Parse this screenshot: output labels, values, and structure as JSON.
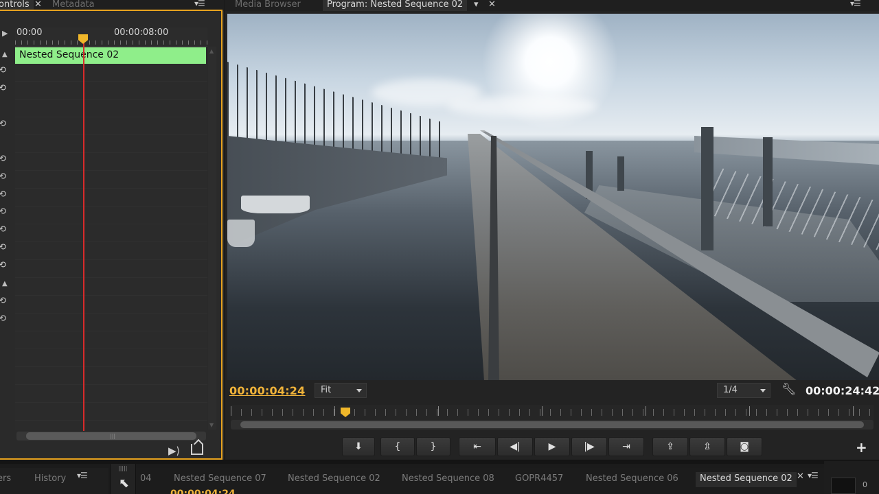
{
  "left_panel": {
    "tabs": [
      {
        "label": "ontrols",
        "active": true
      },
      {
        "label": "Metadata",
        "active": false
      }
    ],
    "ruler": {
      "start": "00:00",
      "mark": "00:00:08:00"
    },
    "clip_name": "Nested Sequence 02",
    "colors": {
      "clip": "#8fee8a",
      "playhead": "#d92a2a",
      "focus": "#e8a31f"
    }
  },
  "program": {
    "tabs": [
      {
        "label": "Media Browser",
        "active": false
      },
      {
        "label": "Program: Nested Sequence 02",
        "active": true
      }
    ],
    "playhead_timecode": "00:00:04:24",
    "zoom": "Fit",
    "resolution": "1/4",
    "duration_timecode": "00:00:24:42",
    "colors": {
      "timecode": "#f0b33a"
    },
    "transport": [
      {
        "name": "add-marker",
        "glyph": "⬇"
      },
      {
        "name": "mark-in",
        "glyph": "{"
      },
      {
        "name": "mark-out",
        "glyph": "}"
      },
      {
        "name": "go-to-in",
        "glyph": "⇤"
      },
      {
        "name": "step-back",
        "glyph": "◀|"
      },
      {
        "name": "play",
        "glyph": "▶"
      },
      {
        "name": "step-forward",
        "glyph": "|▶"
      },
      {
        "name": "go-to-out",
        "glyph": "⇥"
      },
      {
        "name": "lift",
        "glyph": "⇪"
      },
      {
        "name": "extract",
        "glyph": "⇫"
      },
      {
        "name": "export-frame",
        "glyph": "◙"
      }
    ],
    "add_button": "+"
  },
  "bottom": {
    "left_tabs": [
      {
        "label": "ers",
        "active": false
      },
      {
        "label": "History",
        "active": false
      }
    ],
    "sequence_tabs": [
      {
        "label": "04",
        "active": false
      },
      {
        "label": "Nested Sequence 07",
        "active": false
      },
      {
        "label": "Nested Sequence 02",
        "active": false
      },
      {
        "label": "Nested Sequence 08",
        "active": false
      },
      {
        "label": "GOPR4457",
        "active": false
      },
      {
        "label": "Nested Sequence 06",
        "active": false
      },
      {
        "label": "Nested Sequence 02",
        "active": true
      }
    ],
    "timecode_partial": "00:00:04:24",
    "meter_value": "0"
  }
}
